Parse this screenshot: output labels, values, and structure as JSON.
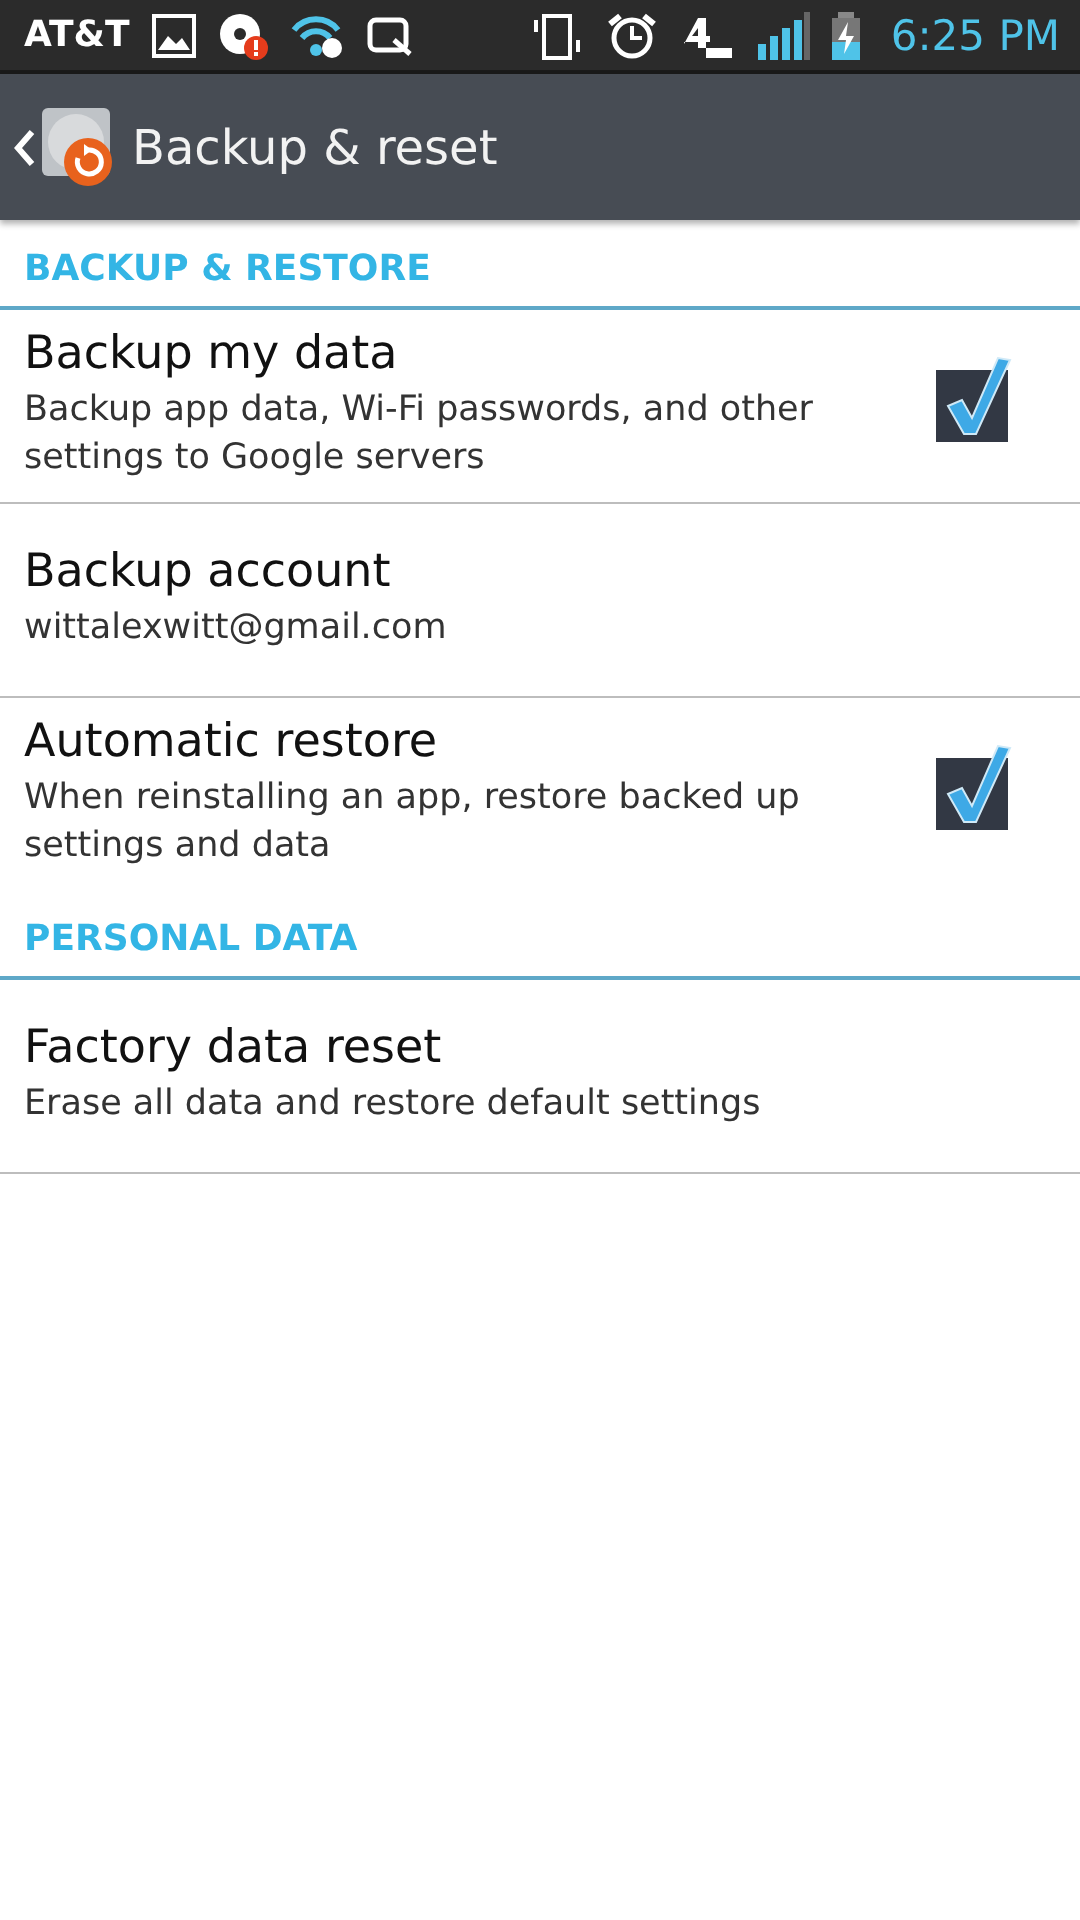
{
  "status_bar": {
    "carrier": "AT&T",
    "time": "6:25 PM"
  },
  "action_bar": {
    "title": "Backup & reset"
  },
  "sections": [
    {
      "title": "BACKUP & RESTORE",
      "items": [
        {
          "kind": "checkbox",
          "title": "Backup my data",
          "summary": "Backup app data, Wi-Fi passwords, and other settings to Google servers",
          "checked": true
        },
        {
          "kind": "plain",
          "title": "Backup account",
          "summary": "wittalexwitt@gmail.com"
        },
        {
          "kind": "checkbox",
          "title": "Automatic restore",
          "summary": "When reinstalling an app, restore backed up settings and data",
          "checked": true
        }
      ]
    },
    {
      "title": "PERSONAL DATA",
      "items": [
        {
          "kind": "plain",
          "title": "Factory data reset",
          "summary": "Erase all data and restore default settings"
        }
      ]
    }
  ]
}
